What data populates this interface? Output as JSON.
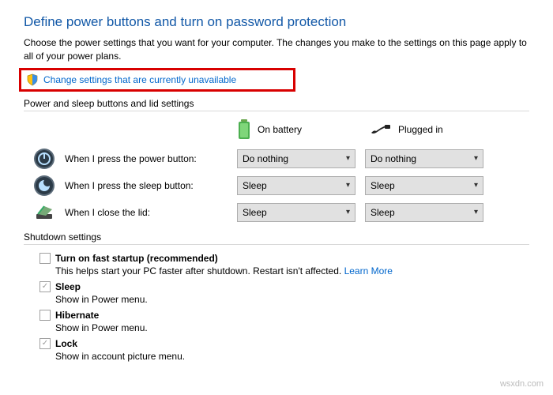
{
  "title": "Define power buttons and turn on password protection",
  "description": "Choose the power settings that you want for your computer. The changes you make to the settings on this page apply to all of your power plans.",
  "change_link": "Change settings that are currently unavailable",
  "section1_header": "Power and sleep buttons and lid settings",
  "columns": {
    "battery": "On battery",
    "plugged": "Plugged in"
  },
  "rows": [
    {
      "label": "When I press the power button:",
      "battery": "Do nothing",
      "plugged": "Do nothing"
    },
    {
      "label": "When I press the sleep button:",
      "battery": "Sleep",
      "plugged": "Sleep"
    },
    {
      "label": "When I close the lid:",
      "battery": "Sleep",
      "plugged": "Sleep"
    }
  ],
  "section2_header": "Shutdown settings",
  "shutdown": {
    "fast_startup": {
      "label": "Turn on fast startup (recommended)",
      "sub": "This helps start your PC faster after shutdown. Restart isn't affected. ",
      "learn_more": "Learn More",
      "checked": false
    },
    "sleep": {
      "label": "Sleep",
      "sub": "Show in Power menu.",
      "checked": true
    },
    "hibernate": {
      "label": "Hibernate",
      "sub": "Show in Power menu.",
      "checked": false
    },
    "lock": {
      "label": "Lock",
      "sub": "Show in account picture menu.",
      "checked": true
    }
  },
  "watermark": "wsxdn.com"
}
